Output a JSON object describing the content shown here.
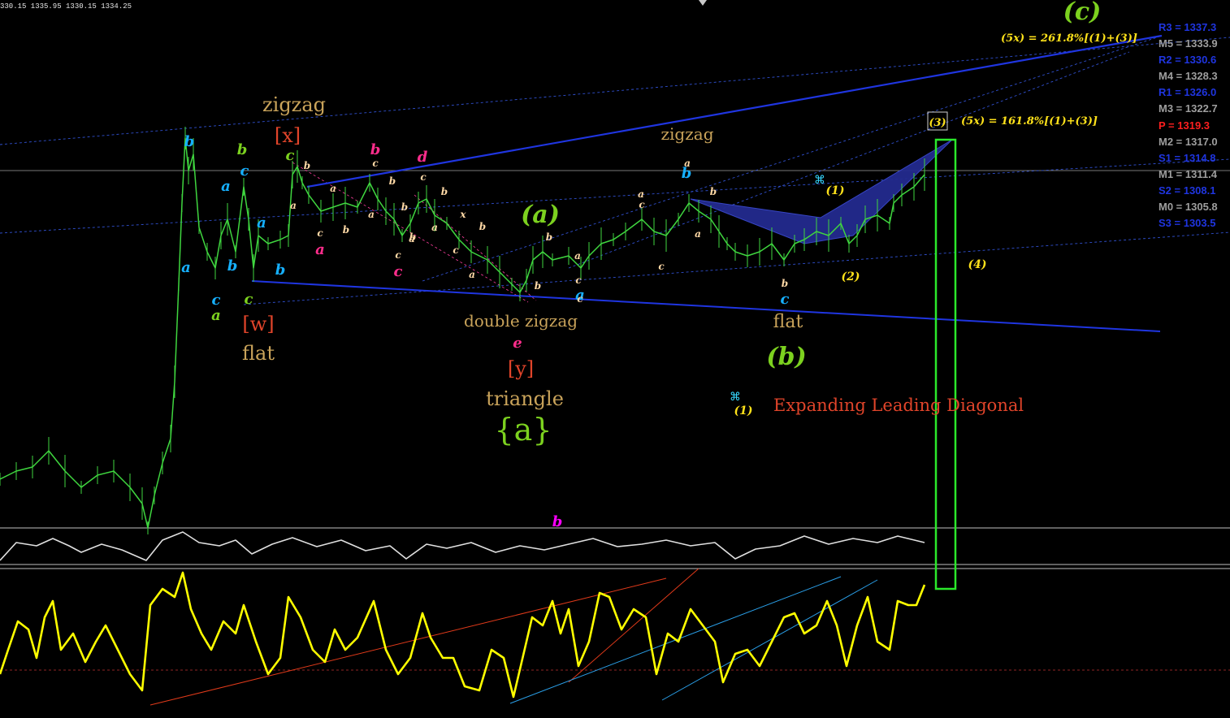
{
  "ohlc_text": "330.15 1335.95 1330.15 1334.25",
  "colors": {
    "background": "#000000",
    "price_line": "#3fd63f",
    "channel": "#1f35e0",
    "oscillator": "#ffff00",
    "rsi_line": "#e0e0e0",
    "box": "#2be82b",
    "wedge": "#232b8f"
  },
  "pivot_levels": [
    {
      "label": "R3 = 1337.3",
      "color": "#1f35e0"
    },
    {
      "label": "M5 = 1333.9",
      "color": "#9e9e9e"
    },
    {
      "label": "R2 = 1330.6",
      "color": "#1f35e0"
    },
    {
      "label": "M4 = 1328.3",
      "color": "#9e9e9e"
    },
    {
      "label": "R1 = 1326.0",
      "color": "#1f35e0"
    },
    {
      "label": "M3 = 1322.7",
      "color": "#9e9e9e"
    },
    {
      "label": "P   = 1319.3",
      "color": "#ff1f1f"
    },
    {
      "label": "M2 = 1317.0",
      "color": "#9e9e9e"
    },
    {
      "label": "S1 = 1314.8",
      "color": "#1f35e0"
    },
    {
      "label": "M1 = 1311.4",
      "color": "#9e9e9e"
    },
    {
      "label": "S2 = 1308.1",
      "color": "#1f35e0"
    },
    {
      "label": "M0 = 1305.8",
      "color": "#9e9e9e"
    },
    {
      "label": "S3 = 1303.5",
      "color": "#1f35e0"
    }
  ],
  "annotations": {
    "zigzag_left": "zigzag",
    "x_label": "[x]",
    "w_label": "[w]",
    "flat_left": "flat",
    "double_zigzag": "double zigzag",
    "y_label": "[y]",
    "triangle": "triangle",
    "a_brace": "{a}",
    "zigzag_mid": "zigzag",
    "flat_mid": "flat",
    "a_paren": "(a)",
    "b_paren": "(b)",
    "c_paren": "(c)",
    "target_1618": "(5x) = 161.8%[(1)+(3)]",
    "target_2618": "(5x) = 261.8%[(1)+(3)]",
    "wave_1": "(1)",
    "wave_2": "(2)",
    "wave_3": "(3)",
    "wave_4": "(4)",
    "diag_marker": "⌘",
    "legend_wave": "(1)",
    "legend_text": "Expanding Leading Diagonal"
  },
  "wave_labels": [
    {
      "t": "b",
      "c": "#16b0ff"
    },
    {
      "t": "b",
      "c": "#7cd11f"
    },
    {
      "t": "c",
      "c": "#16b0ff"
    },
    {
      "t": "a",
      "c": "#16b0ff"
    },
    {
      "t": "a",
      "c": "#16b0ff"
    },
    {
      "t": "a",
      "c": "#16b0ff"
    },
    {
      "t": "b",
      "c": "#16b0ff"
    },
    {
      "t": "b",
      "c": "#16b0ff"
    },
    {
      "t": "c",
      "c": "#16b0ff"
    },
    {
      "t": "a",
      "c": "#7cd11f"
    },
    {
      "t": "c",
      "c": "#7cd11f"
    },
    {
      "t": "c",
      "c": "#7cd11f"
    },
    {
      "t": "b",
      "c": "#ffd9a6"
    },
    {
      "t": "a",
      "c": "#ffd9a6"
    },
    {
      "t": "a",
      "c": "#ffd9a6"
    },
    {
      "t": "b",
      "c": "#ffd9a6"
    },
    {
      "t": "c",
      "c": "#ffd9a6"
    },
    {
      "t": "a",
      "c": "#ff2d8c"
    },
    {
      "t": "b",
      "c": "#ff2d8c"
    },
    {
      "t": "c",
      "c": "#ffd9a6"
    },
    {
      "t": "a",
      "c": "#ffd9a6"
    },
    {
      "t": "b",
      "c": "#ffd9a6"
    },
    {
      "t": "b",
      "c": "#ffd9a6"
    },
    {
      "t": "a",
      "c": "#ffd9a6"
    },
    {
      "t": "b",
      "c": "#ffd9a6"
    },
    {
      "t": "c",
      "c": "#ffd9a6"
    },
    {
      "t": "c",
      "c": "#ff2d8c"
    },
    {
      "t": "d",
      "c": "#ff2d8c"
    },
    {
      "t": "c",
      "c": "#ffd9a6"
    },
    {
      "t": "b",
      "c": "#ffd9a6"
    },
    {
      "t": "a",
      "c": "#ffd9a6"
    },
    {
      "t": "b",
      "c": "#ffd9a6"
    },
    {
      "t": "x",
      "c": "#ffd9a6"
    },
    {
      "t": "c",
      "c": "#ffd9a6"
    },
    {
      "t": "b",
      "c": "#ffd9a6"
    },
    {
      "t": "a",
      "c": "#ffd9a6"
    },
    {
      "t": "a",
      "c": "#ffd9a6"
    },
    {
      "t": "c",
      "c": "#ffd9a6"
    },
    {
      "t": "e",
      "c": "#ff2d8c"
    },
    {
      "t": "b",
      "c": "#ffd9a6"
    },
    {
      "t": "a",
      "c": "#ffd9a6"
    },
    {
      "t": "c",
      "c": "#ffd9a6"
    },
    {
      "t": "a",
      "c": "#16b0ff"
    },
    {
      "t": "a",
      "c": "#ffd9a6"
    },
    {
      "t": "b",
      "c": "#ffd9a6"
    },
    {
      "t": "a",
      "c": "#ffd9a6"
    },
    {
      "t": "b",
      "c": "#16b0ff"
    },
    {
      "t": "c",
      "c": "#ffd9a6"
    },
    {
      "t": "b",
      "c": "#ffd9a6"
    },
    {
      "t": "c",
      "c": "#ffd9a6"
    },
    {
      "t": "c",
      "c": "#16b0ff"
    },
    {
      "t": "b",
      "c": "#ff00ff"
    }
  ],
  "chart_data": {
    "type": "line",
    "axes_labeled": false,
    "right_axis_levels": [
      "1337.3",
      "1333.9",
      "1330.6",
      "1328.3",
      "1326.0",
      "1322.7",
      "1319.3",
      "1317.0",
      "1314.8",
      "1311.4",
      "1308.1",
      "1305.8",
      "1303.5"
    ],
    "price_path": [
      [
        0,
        590
      ],
      [
        20,
        580
      ],
      [
        40,
        575
      ],
      [
        60,
        555
      ],
      [
        80,
        580
      ],
      [
        100,
        600
      ],
      [
        120,
        585
      ],
      [
        140,
        580
      ],
      [
        160,
        600
      ],
      [
        175,
        620
      ],
      [
        182,
        650
      ],
      [
        190,
        610
      ],
      [
        200,
        570
      ],
      [
        210,
        540
      ],
      [
        215,
        470
      ],
      [
        220,
        350
      ],
      [
        224,
        250
      ],
      [
        228,
        170
      ],
      [
        232,
        210
      ],
      [
        238,
        190
      ],
      [
        245,
        280
      ],
      [
        255,
        310
      ],
      [
        265,
        330
      ],
      [
        272,
        290
      ],
      [
        280,
        270
      ],
      [
        290,
        310
      ],
      [
        300,
        230
      ],
      [
        306,
        270
      ],
      [
        312,
        330
      ],
      [
        318,
        290
      ],
      [
        330,
        300
      ],
      [
        345,
        295
      ],
      [
        355,
        290
      ],
      [
        360,
        215
      ],
      [
        366,
        205
      ],
      [
        372,
        225
      ],
      [
        380,
        240
      ],
      [
        395,
        260
      ],
      [
        410,
        255
      ],
      [
        425,
        250
      ],
      [
        440,
        255
      ],
      [
        455,
        225
      ],
      [
        465,
        245
      ],
      [
        475,
        260
      ],
      [
        485,
        270
      ],
      [
        495,
        290
      ],
      [
        505,
        275
      ],
      [
        515,
        250
      ],
      [
        525,
        245
      ],
      [
        535,
        265
      ],
      [
        550,
        275
      ],
      [
        565,
        295
      ],
      [
        580,
        310
      ],
      [
        600,
        320
      ],
      [
        615,
        335
      ],
      [
        630,
        350
      ],
      [
        640,
        360
      ],
      [
        648,
        345
      ],
      [
        656,
        320
      ],
      [
        668,
        310
      ],
      [
        680,
        320
      ],
      [
        700,
        315
      ],
      [
        715,
        330
      ],
      [
        725,
        315
      ],
      [
        740,
        300
      ],
      [
        755,
        295
      ],
      [
        770,
        285
      ],
      [
        790,
        270
      ],
      [
        805,
        285
      ],
      [
        820,
        290
      ],
      [
        835,
        270
      ],
      [
        848,
        250
      ],
      [
        860,
        260
      ],
      [
        875,
        270
      ],
      [
        885,
        285
      ],
      [
        895,
        300
      ],
      [
        905,
        310
      ],
      [
        920,
        315
      ],
      [
        935,
        310
      ],
      [
        950,
        300
      ],
      [
        965,
        320
      ],
      [
        978,
        300
      ],
      [
        990,
        295
      ],
      [
        1005,
        285
      ],
      [
        1020,
        290
      ],
      [
        1035,
        275
      ],
      [
        1045,
        300
      ],
      [
        1055,
        290
      ],
      [
        1065,
        270
      ],
      [
        1080,
        265
      ],
      [
        1095,
        275
      ],
      [
        1100,
        250
      ],
      [
        1110,
        240
      ],
      [
        1125,
        230
      ],
      [
        1138,
        215
      ]
    ],
    "rsi_path": [
      [
        0,
        690
      ],
      [
        20,
        668
      ],
      [
        45,
        672
      ],
      [
        65,
        663
      ],
      [
        85,
        672
      ],
      [
        100,
        680
      ],
      [
        125,
        670
      ],
      [
        150,
        677
      ],
      [
        180,
        690
      ],
      [
        200,
        665
      ],
      [
        225,
        655
      ],
      [
        245,
        668
      ],
      [
        270,
        672
      ],
      [
        290,
        665
      ],
      [
        310,
        682
      ],
      [
        335,
        670
      ],
      [
        360,
        662
      ],
      [
        390,
        673
      ],
      [
        420,
        665
      ],
      [
        450,
        678
      ],
      [
        480,
        672
      ],
      [
        500,
        688
      ],
      [
        525,
        670
      ],
      [
        550,
        675
      ],
      [
        580,
        668
      ],
      [
        610,
        680
      ],
      [
        640,
        672
      ],
      [
        670,
        677
      ],
      [
        700,
        670
      ],
      [
        730,
        663
      ],
      [
        760,
        673
      ],
      [
        790,
        670
      ],
      [
        820,
        665
      ],
      [
        850,
        672
      ],
      [
        880,
        668
      ],
      [
        905,
        688
      ],
      [
        930,
        676
      ],
      [
        960,
        672
      ],
      [
        990,
        660
      ],
      [
        1020,
        670
      ],
      [
        1050,
        663
      ],
      [
        1080,
        668
      ],
      [
        1105,
        660
      ],
      [
        1138,
        668
      ]
    ],
    "oscillator_path": [
      [
        0,
        830
      ],
      [
        10,
        800
      ],
      [
        22,
        765
      ],
      [
        35,
        775
      ],
      [
        45,
        810
      ],
      [
        55,
        760
      ],
      [
        65,
        740
      ],
      [
        75,
        800
      ],
      [
        90,
        780
      ],
      [
        105,
        815
      ],
      [
        118,
        790
      ],
      [
        130,
        770
      ],
      [
        145,
        800
      ],
      [
        160,
        830
      ],
      [
        175,
        850
      ],
      [
        185,
        745
      ],
      [
        200,
        725
      ],
      [
        215,
        735
      ],
      [
        225,
        705
      ],
      [
        235,
        750
      ],
      [
        248,
        780
      ],
      [
        260,
        800
      ],
      [
        275,
        765
      ],
      [
        290,
        780
      ],
      [
        300,
        745
      ],
      [
        315,
        790
      ],
      [
        330,
        830
      ],
      [
        345,
        810
      ],
      [
        355,
        735
      ],
      [
        370,
        760
      ],
      [
        385,
        800
      ],
      [
        400,
        815
      ],
      [
        412,
        775
      ],
      [
        425,
        800
      ],
      [
        440,
        785
      ],
      [
        460,
        740
      ],
      [
        475,
        800
      ],
      [
        490,
        830
      ],
      [
        505,
        810
      ],
      [
        520,
        755
      ],
      [
        530,
        785
      ],
      [
        545,
        810
      ],
      [
        558,
        810
      ],
      [
        572,
        845
      ],
      [
        590,
        850
      ],
      [
        605,
        800
      ],
      [
        620,
        810
      ],
      [
        632,
        858
      ],
      [
        648,
        790
      ],
      [
        655,
        760
      ],
      [
        668,
        770
      ],
      [
        680,
        740
      ],
      [
        690,
        780
      ],
      [
        700,
        750
      ],
      [
        712,
        820
      ],
      [
        725,
        790
      ],
      [
        738,
        730
      ],
      [
        750,
        735
      ],
      [
        765,
        775
      ],
      [
        780,
        750
      ],
      [
        795,
        760
      ],
      [
        808,
        830
      ],
      [
        822,
        780
      ],
      [
        835,
        790
      ],
      [
        850,
        750
      ],
      [
        865,
        770
      ],
      [
        880,
        790
      ],
      [
        890,
        840
      ],
      [
        905,
        805
      ],
      [
        920,
        800
      ],
      [
        935,
        820
      ],
      [
        950,
        790
      ],
      [
        965,
        760
      ],
      [
        978,
        755
      ],
      [
        990,
        780
      ],
      [
        1005,
        770
      ],
      [
        1018,
        740
      ],
      [
        1030,
        770
      ],
      [
        1042,
        820
      ],
      [
        1055,
        770
      ],
      [
        1068,
        735
      ],
      [
        1080,
        790
      ],
      [
        1095,
        800
      ],
      [
        1105,
        740
      ],
      [
        1118,
        745
      ],
      [
        1128,
        745
      ],
      [
        1138,
        720
      ]
    ]
  }
}
